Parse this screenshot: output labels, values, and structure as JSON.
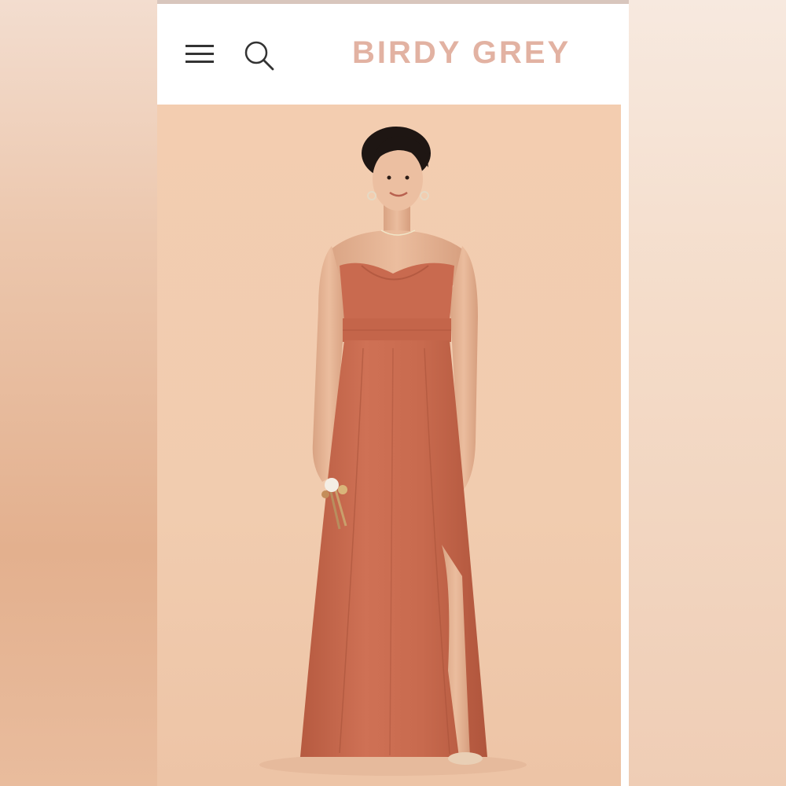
{
  "header": {
    "brand": "BIRDY GREY",
    "menu_icon": "hamburger-menu-icon",
    "search_icon": "search-icon"
  },
  "hero": {
    "image_subject": "model-wearing-strapless-terracotta-maxi-dress"
  },
  "colors": {
    "brand": "#e2b2a2",
    "dress": "#c96a4f",
    "background": "#f2ccaf"
  }
}
